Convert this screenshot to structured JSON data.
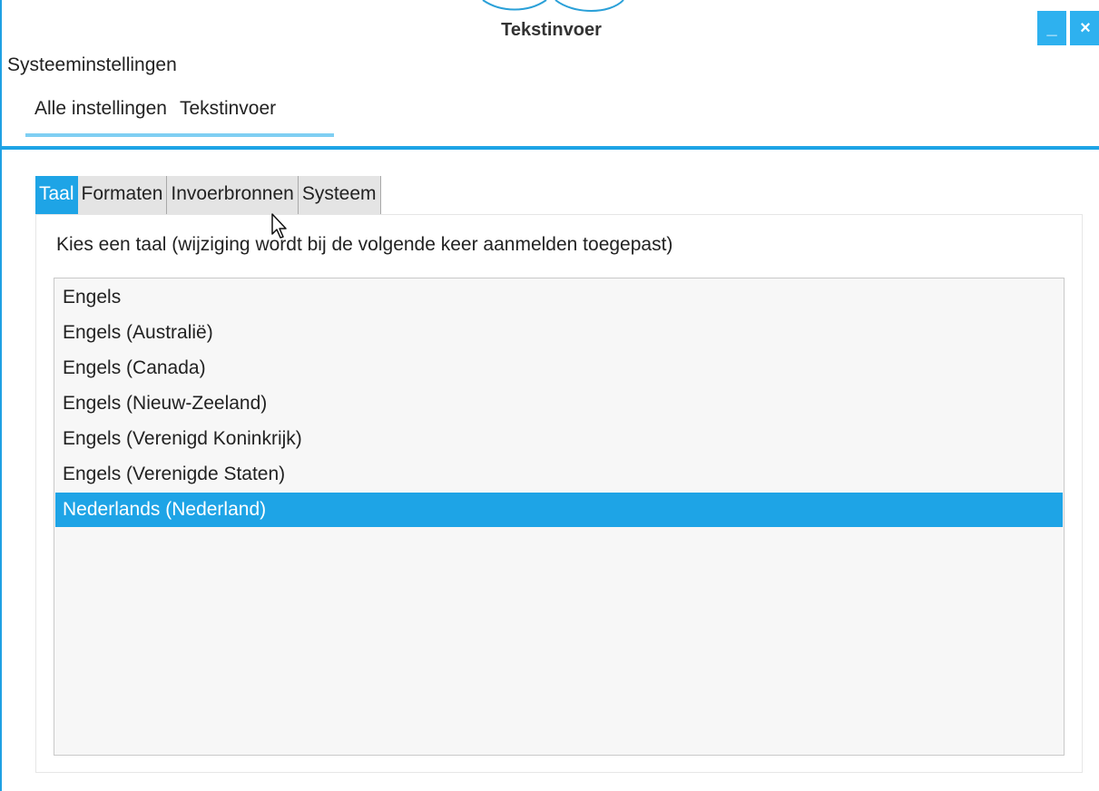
{
  "window": {
    "title": "Tekstinvoer",
    "minimize_label": "_",
    "close_label": "×"
  },
  "app": {
    "name": "Systeeminstellingen"
  },
  "breadcrumb": {
    "items": [
      "Alle instellingen",
      "Tekstinvoer"
    ]
  },
  "tabs": [
    {
      "label": "Taal",
      "active": true
    },
    {
      "label": "Formaten",
      "active": false
    },
    {
      "label": "Invoerbronnen",
      "active": false
    },
    {
      "label": "Systeem",
      "active": false
    }
  ],
  "language_panel": {
    "prompt": "Kies een taal (wijziging wordt bij de volgende keer aanmelden toegepast)",
    "languages": [
      "Engels",
      "Engels (Australië)",
      "Engels (Canada)",
      "Engels (Nieuw-Zeeland)",
      "Engels (Verenigd Koninkrijk)",
      "Engels (Verenigde Staten)",
      "Nederlands (Nederland)"
    ],
    "selected": "Nederlands (Nederland)"
  },
  "colors": {
    "accent": "#1ea4e6",
    "window_button": "#2eb1ef",
    "breadcrumb_underline": "#7fcff3"
  }
}
